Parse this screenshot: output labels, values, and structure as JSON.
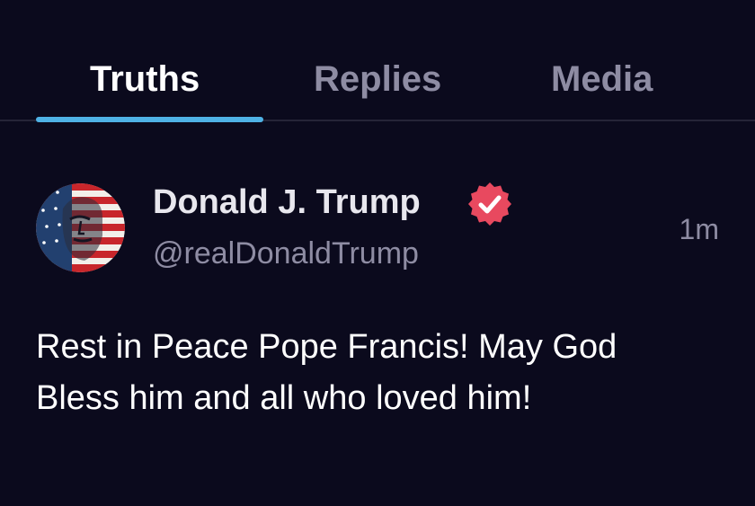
{
  "tabs": [
    {
      "label": "Truths",
      "active": true
    },
    {
      "label": "Replies",
      "active": false
    },
    {
      "label": "Media",
      "active": false
    }
  ],
  "colors": {
    "background": "#0b0a1d",
    "active_tab_indicator": "#4fb2e5",
    "muted_text": "#8e8ca3",
    "verified_badge": "#e8495f"
  },
  "post": {
    "author": {
      "display_name": "Donald J. Trump",
      "handle": "@realDonaldTrump",
      "verified": true,
      "avatar_icon": "american-flag-portrait-avatar"
    },
    "timestamp": "1m",
    "body": "Rest in Peace Pope Francis! May God Bless him and all who loved him!"
  }
}
